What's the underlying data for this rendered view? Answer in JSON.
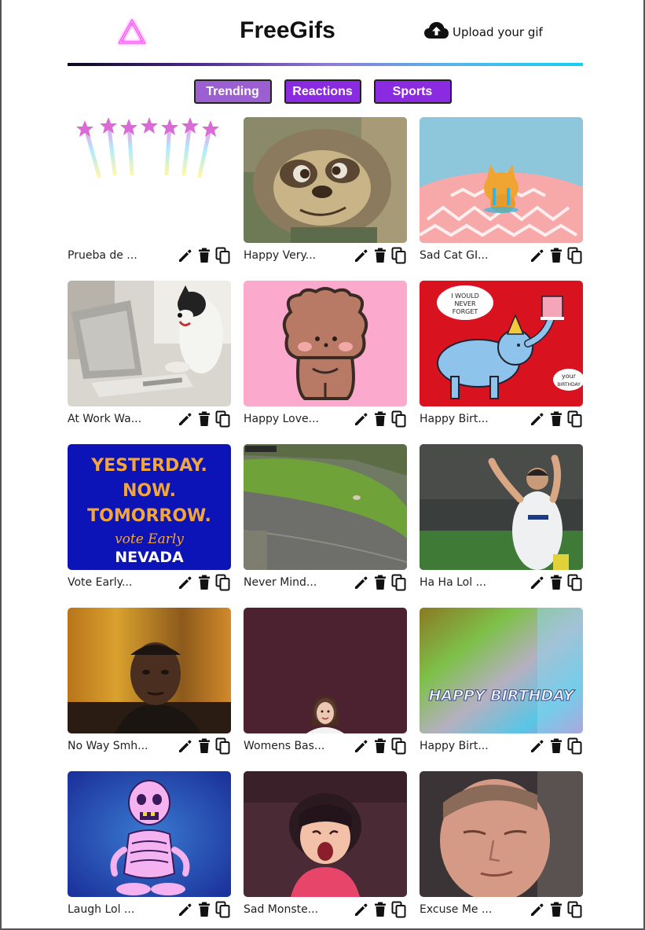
{
  "header": {
    "brand": "FreeGifs",
    "upload_label": "Upload your gif"
  },
  "tabs": [
    {
      "label": "Trending"
    },
    {
      "label": "Reactions"
    },
    {
      "label": "Sports"
    }
  ],
  "gifs": [
    {
      "title": "Prueba de ...",
      "scene": "thanks-text"
    },
    {
      "title": "Happy Very...",
      "scene": "sloth"
    },
    {
      "title": "Sad Cat GI...",
      "scene": "sad-cat"
    },
    {
      "title": "At Work Wa...",
      "scene": "dog-at-computer"
    },
    {
      "title": "Happy Love...",
      "scene": "bear-cartoon"
    },
    {
      "title": "Happy Birt...",
      "scene": "elephant-cake",
      "card_text": [
        "I WOULD",
        "NEVER",
        "FORGET",
        "your",
        "BIRTHDAY"
      ]
    },
    {
      "title": "Vote Early...",
      "scene": "vote-poster",
      "card_text": [
        "YESTERDAY.",
        "NOW.",
        "TOMORROW.",
        "vote Early",
        "NEVADA"
      ]
    },
    {
      "title": "Never Mind...",
      "scene": "road"
    },
    {
      "title": "Ha Ha Lol ...",
      "scene": "soccer"
    },
    {
      "title": "No Way Smh...",
      "scene": "man-portrait"
    },
    {
      "title": "Womens Bas...",
      "scene": "woman-purple"
    },
    {
      "title": "Happy Birt...",
      "scene": "happy-birthday-text",
      "card_text": [
        "HAPPY BIRTHDAY"
      ]
    },
    {
      "title": "Laugh Lol ...",
      "scene": "skeleton"
    },
    {
      "title": "Sad Monste...",
      "scene": "crying-girl"
    },
    {
      "title": "Excuse Me ...",
      "scene": "man-eyes-closed"
    }
  ],
  "icons": {
    "logo": "triangle-logo-icon",
    "upload": "cloud-upload-icon",
    "edit": "pencil-icon",
    "delete": "trash-icon",
    "copy": "copy-icon"
  },
  "colors": {
    "accent": "#8a2be2",
    "accent_active": "#9c5fd1",
    "logo_glow": "#ff40ff"
  }
}
